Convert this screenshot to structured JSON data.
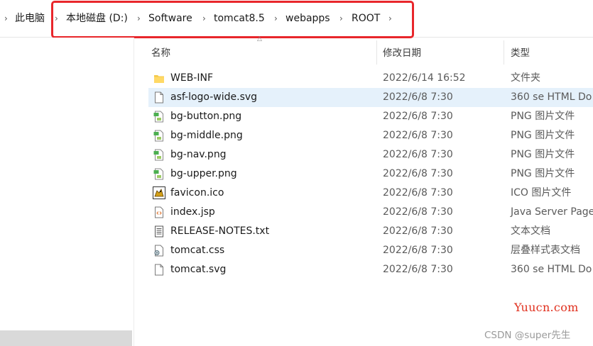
{
  "breadcrumb": {
    "items": [
      {
        "label": "此电脑"
      },
      {
        "label": "本地磁盘 (D:)"
      },
      {
        "label": "Software"
      },
      {
        "label": "tomcat8.5"
      },
      {
        "label": "webapps"
      },
      {
        "label": "ROOT"
      }
    ],
    "separator": "›"
  },
  "columns": {
    "name": "名称",
    "modified": "修改日期",
    "type": "类型"
  },
  "files": [
    {
      "name": "WEB-INF",
      "modified": "2022/6/14 16:52",
      "type": "文件夹",
      "icon": "folder-icon",
      "selected": false
    },
    {
      "name": "asf-logo-wide.svg",
      "modified": "2022/6/8 7:30",
      "type": "360 se HTML Do",
      "icon": "document-icon",
      "selected": true
    },
    {
      "name": "bg-button.png",
      "modified": "2022/6/8 7:30",
      "type": "PNG 图片文件",
      "icon": "image-file-icon",
      "selected": false
    },
    {
      "name": "bg-middle.png",
      "modified": "2022/6/8 7:30",
      "type": "PNG 图片文件",
      "icon": "image-file-icon",
      "selected": false
    },
    {
      "name": "bg-nav.png",
      "modified": "2022/6/8 7:30",
      "type": "PNG 图片文件",
      "icon": "image-file-icon",
      "selected": false
    },
    {
      "name": "bg-upper.png",
      "modified": "2022/6/8 7:30",
      "type": "PNG 图片文件",
      "icon": "image-file-icon",
      "selected": false
    },
    {
      "name": "favicon.ico",
      "modified": "2022/6/8 7:30",
      "type": "ICO 图片文件",
      "icon": "tomcat-logo-icon",
      "selected": false
    },
    {
      "name": "index.jsp",
      "modified": "2022/6/8 7:30",
      "type": "Java Server Page",
      "icon": "code-file-icon",
      "selected": false
    },
    {
      "name": "RELEASE-NOTES.txt",
      "modified": "2022/6/8 7:30",
      "type": "文本文档",
      "icon": "text-file-icon",
      "selected": false
    },
    {
      "name": "tomcat.css",
      "modified": "2022/6/8 7:30",
      "type": "层叠样式表文档",
      "icon": "css-file-icon",
      "selected": false
    },
    {
      "name": "tomcat.svg",
      "modified": "2022/6/8 7:30",
      "type": "360 se HTML Do",
      "icon": "document-icon",
      "selected": false
    }
  ],
  "watermarks": {
    "site": "Yuucn.com",
    "author": "CSDN @super先生"
  },
  "colors": {
    "highlight": "#e8262b",
    "selection": "#e5f1fb",
    "watermark_site": "#e0301e"
  }
}
